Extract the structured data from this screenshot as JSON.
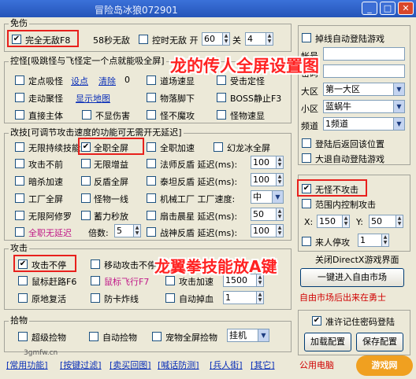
{
  "window": {
    "title": "冒险岛冰狼072901",
    "min": "_",
    "max": "□",
    "close": "✕"
  },
  "overlay": {
    "title": "龙的传人全屏设置图",
    "sub": "龙翼拳技能放A键"
  },
  "watermark": {
    "site": "3gmfw.cn",
    "brand": "游戏网"
  },
  "mianshang": {
    "title": "免伤",
    "full": "完全无敌F8",
    "full_checked": true,
    "s58": "58秒无敌",
    "timed": "控时无敌 开",
    "on_val": "60",
    "off_label": "关",
    "off_val": "4"
  },
  "kongguai": {
    "title": "控怪[吸跳怪与飞怪定一个点就能吸全屏]",
    "dingdian": "定点吸怪",
    "setpoint": "设点",
    "clear": "清除",
    "count": "0",
    "zouzou": "走动聚怪",
    "showmap": "显示地图",
    "direct": "直接主体",
    "noshow": "不显伤害",
    "col2": [
      "道场速显",
      "物落脚下",
      "怪不魔攻"
    ],
    "col3": [
      "受击定怪",
      "BOSS静止F3",
      "怪物速显"
    ]
  },
  "gaiji": {
    "title": "改技[可调节攻击速度的功能可无需开无延迟]",
    "c1": [
      "无限持续技能",
      "攻击不前",
      "暗杀加速",
      "工厂全屏",
      "无限阿修罗",
      "全职无延迟"
    ],
    "c2": [
      "全职全屏",
      "无限增益",
      "反盾全屏",
      "怪物一线",
      "蓄力秒放",
      "倍数:"
    ],
    "mult": "5",
    "c3": [
      "全职加速",
      "法师反盾 延迟(ms):",
      "泰坦反盾 延迟(ms):",
      "机械工厂 工厂速度:",
      "扇击晨星 延迟(ms):",
      "战神反盾 延迟(ms):"
    ],
    "v3": [
      "100",
      "100",
      "中",
      "50",
      "100"
    ],
    "hx": "幻龙冰全屏"
  },
  "gongji": {
    "title": "攻击",
    "attack": "攻击不停",
    "move": "移动攻击不停",
    "mouse": "鼠标赶路F6",
    "fly": "鼠标飞行F7",
    "revive": "原地复活",
    "antikick": "防卡炸线",
    "speed": "攻击加速",
    "speed_val": "1500",
    "autodrop": "自动掉血",
    "drop_val": "1"
  },
  "shiwu": {
    "title": "拾物",
    "super": "超级捡物",
    "auto": "自动捡物",
    "pet": "宠物全屏捡物",
    "mode": "挂机"
  },
  "tabs": [
    "[常用功能]",
    "[按键过滤]",
    "[卖买回图]",
    "[喊话防测]",
    "[兵人街]",
    "[其它]"
  ],
  "right": {
    "relogin": "掉线自动登陆游戏",
    "account_label": "帐号",
    "account": "",
    "pw_label": "密码",
    "pw": "",
    "region_label": "大区",
    "region": "第一大区",
    "sub_label": "小区",
    "sub": "蓝蜗牛",
    "ch_label": "频道",
    "ch": "1频道",
    "pos": "登陆后返回该位置",
    "auto_big": "大退自动登陆游戏",
    "nohit": "无怪不攻击",
    "range": "范围内控制攻击",
    "x_label": "X:",
    "x": "150",
    "y_label": "Y:",
    "y": "50",
    "hp": "来人停攻",
    "hp_val": "1",
    "directx": "关闭DirectX游戏界面",
    "market_btn": "一键进入自由市场",
    "market_note": "自由市场后出来在勇士",
    "save_pw": "准许记住密码登陆",
    "load": "加载配置",
    "save": "保存配置",
    "pub": "公用电脑"
  },
  "colors": {
    "accent": "#2454b8",
    "highlight": "#e8201c",
    "overlay": "#ff2222"
  }
}
